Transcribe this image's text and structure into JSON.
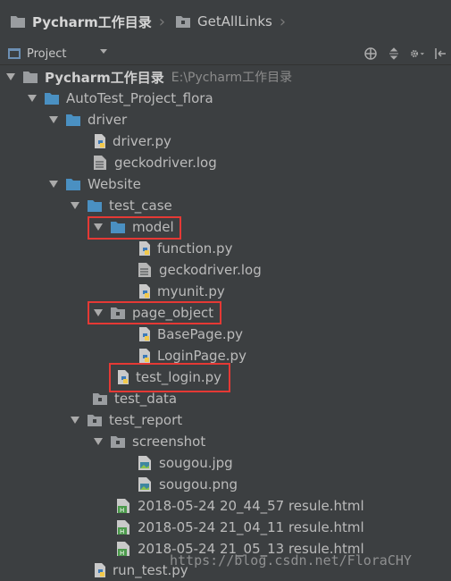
{
  "breadcrumb": {
    "root": "Pycharm工作目录",
    "child": "GetAllLinks"
  },
  "toolbar": {
    "view_label": "Project",
    "icons": [
      "scroll-from-source-icon",
      "collapse-all-icon",
      "settings-icon",
      "hide-icon"
    ]
  },
  "tree": {
    "root": {
      "label": "Pycharm工作目录",
      "path": "E:\\Pycharm工作目录"
    },
    "items": [
      {
        "label": "AutoTest_Project_flora",
        "kind": "folder"
      },
      {
        "label": "driver",
        "kind": "folder"
      },
      {
        "label": "driver.py",
        "kind": "python"
      },
      {
        "label": "geckodriver.log",
        "kind": "log"
      },
      {
        "label": "Website",
        "kind": "folder"
      },
      {
        "label": "test_case",
        "kind": "folder"
      },
      {
        "label": "model",
        "kind": "folder"
      },
      {
        "label": "function.py",
        "kind": "python"
      },
      {
        "label": "geckodriver.log",
        "kind": "log"
      },
      {
        "label": "myunit.py",
        "kind": "python"
      },
      {
        "label": "page_object",
        "kind": "package"
      },
      {
        "label": "BasePage.py",
        "kind": "python"
      },
      {
        "label": "LoginPage.py",
        "kind": "python"
      },
      {
        "label": "test_login.py",
        "kind": "python"
      },
      {
        "label": "test_data",
        "kind": "package"
      },
      {
        "label": "test_report",
        "kind": "package"
      },
      {
        "label": "screenshot",
        "kind": "package"
      },
      {
        "label": "sougou.jpg",
        "kind": "image"
      },
      {
        "label": "sougou.png",
        "kind": "image"
      },
      {
        "label": "2018-05-24 20_44_57 resule.html",
        "kind": "html"
      },
      {
        "label": "2018-05-24 21_04_11 resule.html",
        "kind": "html"
      },
      {
        "label": "2018-05-24 21_05_13 resule.html",
        "kind": "html"
      },
      {
        "label": "run_test.py",
        "kind": "python"
      }
    ]
  },
  "watermark": "https://blog.csdn.net/FloraCHY",
  "colors": {
    "background": "#3c3f41",
    "text": "#bbbbbb",
    "folder": "#4a90c2",
    "highlight": "#e53935"
  }
}
